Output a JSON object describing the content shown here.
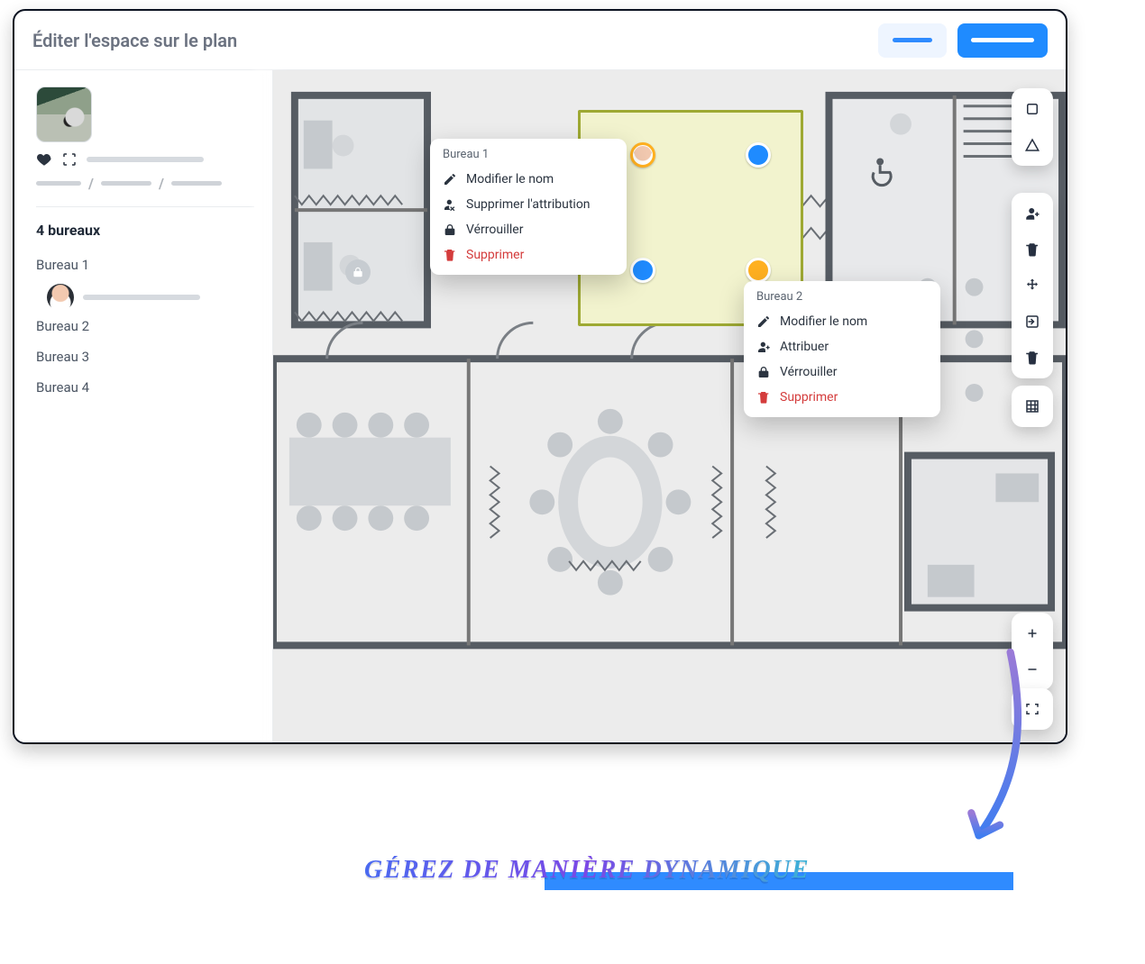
{
  "header": {
    "title": "Éditer l'espace sur le plan",
    "secondary_button_label": "",
    "primary_button_label": ""
  },
  "sidebar": {
    "section_title": "4 bureaux",
    "offices": [
      {
        "label": "Bureau 1",
        "assigned_name_line": ""
      },
      {
        "label": "Bureau 2"
      },
      {
        "label": "Bureau 3"
      },
      {
        "label": "Bureau 4"
      }
    ]
  },
  "context_menus": {
    "bureau1": {
      "title": "Bureau 1",
      "edit_label": "Modifier le nom",
      "unassign_label": "Supprimer l'attribution",
      "lock_label": "Vérrouiller",
      "delete_label": "Supprimer"
    },
    "bureau2": {
      "title": "Bureau 2",
      "edit_label": "Modifier le nom",
      "assign_label": "Attribuer",
      "lock_label": "Vérrouiller",
      "delete_label": "Supprimer"
    }
  },
  "toolbar": {
    "shape_square": "square-icon",
    "shape_triangle": "triangle-icon",
    "assign": "person-add-icon",
    "trash": "trash-icon",
    "move": "move-icon",
    "export": "export-icon",
    "trash2": "trash-icon",
    "grid": "grid-icon",
    "zoom_in": "plus-icon",
    "zoom_out": "minus-icon",
    "fullscreen": "fullscreen-icon"
  },
  "colors": {
    "accent": "#1f8bff",
    "desk_available": "#1f8bff",
    "desk_assigned": "#ffb020",
    "danger": "#d43c3c"
  },
  "promo_text": "Gérez de manière dynamique"
}
